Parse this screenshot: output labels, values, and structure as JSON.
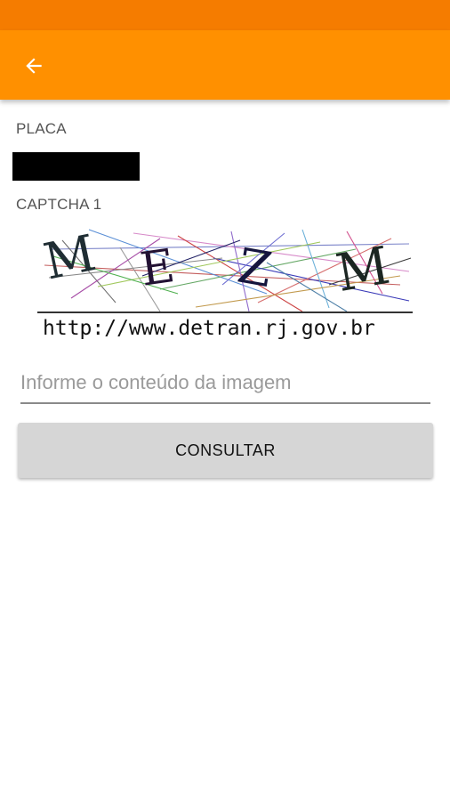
{
  "colors": {
    "status_bar": "#f57c00",
    "app_bar": "#ff9000",
    "button_bg": "#d6d6d6"
  },
  "toolbar": {
    "back_icon": "arrow-left-icon"
  },
  "form": {
    "placa_label": "PLACA",
    "placa_value": "",
    "captcha_label": "CAPTCHA 1",
    "captcha_image": {
      "letters": [
        "M",
        "E",
        "Z",
        "M"
      ],
      "url_text": "http://www.detran.rj.gov.br"
    },
    "captcha_input_placeholder": "Informe o conteúdo da imagem",
    "captcha_input_value": "",
    "submit_label": "CONSULTAR"
  }
}
